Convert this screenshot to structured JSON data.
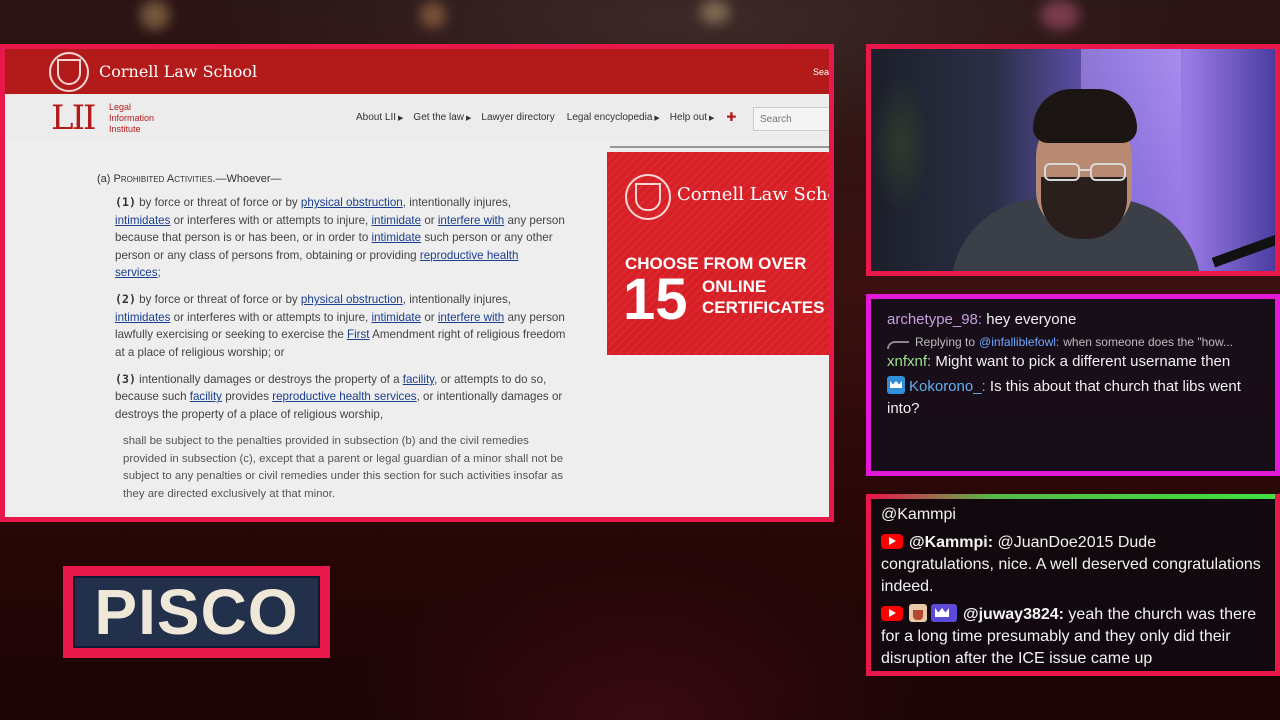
{
  "cornell": {
    "title": "Cornell Law School",
    "search_partial": "Sea"
  },
  "lii": {
    "logo": "LII",
    "logo_text": [
      "Legal",
      "Information",
      "Institute"
    ],
    "nav": [
      {
        "label": "About LII",
        "arrow": "▶"
      },
      {
        "label": "Get the law",
        "arrow": "▶"
      },
      {
        "label": "Lawyer directory",
        "arrow": ""
      },
      {
        "label": "Legal encyclopedia",
        "arrow": "▶"
      },
      {
        "label": "Help out",
        "arrow": "▶"
      }
    ],
    "search_placeholder": "Search"
  },
  "legal": {
    "section_label": "(a)",
    "section_title": "Prohibited Activities.",
    "section_tail": "—Whoever—",
    "clause1": {
      "num": "(1)",
      "t1": " by force or threat of force or by ",
      "l1": "physical obstruction",
      "t2": ", intentionally injures, ",
      "l2": "intimidates",
      "t3": " or interferes with or attempts to injure, ",
      "l3": "intimidate",
      "t4": " or ",
      "l4": "interfere with",
      "t5": " any person because that person is or has been, or in order to ",
      "l5": "intimidate",
      "t6": " such person or any other person or any class of persons from, obtaining or providing ",
      "l6": "reproductive health services",
      "t7": ";"
    },
    "clause2": {
      "num": "(2)",
      "t1": " by force or threat of force or by ",
      "l1": "physical obstruction",
      "t2": ", intentionally injures, ",
      "l2": "intimidates",
      "t3": " or interferes with or attempts to injure, ",
      "l3": "intimidate",
      "t4": " or ",
      "l4": "interfere with",
      "t5": " any person lawfully exercising or seeking to exercise the ",
      "l5": "First",
      "t6": " Amendment right of religious freedom at a place of religious worship; or"
    },
    "clause3": {
      "num": "(3)",
      "t1": " intentionally damages or destroys the property of a ",
      "l1": "facility",
      "t2": ", or attempts to do so, because such ",
      "l2": "facility",
      "t3": " provides ",
      "l3": "reproductive health services",
      "t4": ", or intentionally damages or destroys the property of a place of religious worship,"
    },
    "penalty": "shall be subject to the penalties provided in subsection (b) and the civil remedies provided in subsection (c), except that a parent or legal guardian of a minor shall not be subject to any penalties or civil remedies under this section for such activities insofar as they are directed exclusively at that minor."
  },
  "ad": {
    "title": "Cornell Law School",
    "choose": "CHOOSE  FROM OVER",
    "number": "15",
    "online_lines": [
      "ONLINE",
      "CERTIFICATES"
    ]
  },
  "chat": {
    "msg1": {
      "user": "archetype_98:",
      "text": " hey everyone"
    },
    "reply": {
      "prefix": "Replying to",
      "mention": "@infalliblefowl:",
      "text": "when someone does the \"how..."
    },
    "msg2": {
      "user": "xnfxnf:",
      "text": " Might want to pick a different username then"
    },
    "msg3": {
      "user": "Kokorono_:",
      "text": " Is this about that church that libs went into?"
    }
  },
  "comments": {
    "top_mention": "@Kammpi",
    "c1": {
      "user": "@Kammpi:",
      "text": " @JuanDoe2015 Dude congratulations, nice. A well deserved congratulations indeed."
    },
    "c2": {
      "user": "@juway3824:",
      "text": " yeah the church was there for a long time presumably and they only did their disruption after the ICE issue came up"
    }
  },
  "pisco": {
    "label": "PISCO"
  },
  "colors": {
    "frame_red": "#e8184a",
    "chat_border": "#e21ad8",
    "cornell_red": "#b31b1b",
    "link_blue": "#1a3f8f"
  }
}
